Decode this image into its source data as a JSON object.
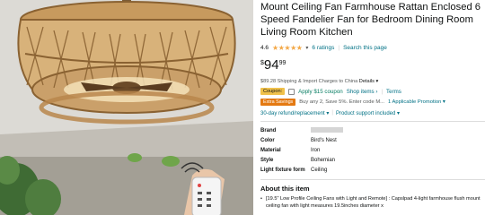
{
  "product": {
    "title": "Mount Ceiling Fan Farmhouse Rattan Enclosed 6 Speed Fandelier Fan for Bedroom Dining Room Living Room Kitchen",
    "rating": "4.6",
    "stars": "★★★★★",
    "ratings_count": "6 ratings",
    "search_link": "Search this page",
    "price_currency": "$",
    "price_whole": "94",
    "price_fraction": "99",
    "shipping_amount": "$89.28 Shipping & Import Charges to China",
    "shipping_details": "Details",
    "coupon_label": "Coupon:",
    "coupon_text": "Apply $15 coupon",
    "coupon_shop": "Shop items",
    "coupon_terms": "Terms",
    "savings_label": "Extra Savings",
    "savings_text": "Buy any 2, Save 5%. Enter code M...",
    "savings_promo": "1 Applicable Promotion",
    "returns_text": "30-day refund/replacement",
    "support_text": "Product support included",
    "about_heading": "About this item",
    "about_bullet": "[19.5\" Low Profile Ceiling Fans with Light and Remote] : Capslpad 4-light farmhouse flush mount ceiling fan with light measures 19.5inches diameter x"
  },
  "specs": [
    {
      "key": "Brand",
      "value": ""
    },
    {
      "key": "Color",
      "value": "Bird's Nest"
    },
    {
      "key": "Material",
      "value": "Iron"
    },
    {
      "key": "Style",
      "value": "Bohemian"
    },
    {
      "key": "Light fixture form",
      "value": "Ceiling"
    }
  ],
  "colors": {
    "link": "#007185",
    "star": "#f3a847",
    "coupon_tag": "#f0c14b",
    "savings_tag": "#e47911",
    "rattan": "#b8864b"
  }
}
